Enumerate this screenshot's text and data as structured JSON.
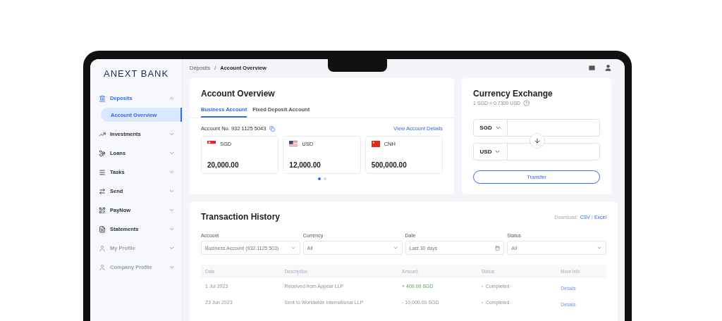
{
  "brand": "ANEXT BANK",
  "breadcrumb": {
    "parent": "Deposits",
    "separator": "/",
    "current": "Account Overview"
  },
  "sidebar": {
    "items": [
      {
        "label": "Deposits",
        "expanded": true,
        "disabled": false,
        "children": [
          {
            "label": "Account Overview",
            "selected": true
          }
        ]
      },
      {
        "label": "Investments",
        "expanded": false,
        "disabled": false
      },
      {
        "label": "Loans",
        "expanded": false,
        "disabled": false
      },
      {
        "label": "Tasks",
        "expanded": false,
        "disabled": false
      },
      {
        "label": "Send",
        "expanded": false,
        "disabled": false
      },
      {
        "label": "PayNow",
        "expanded": false,
        "disabled": false
      },
      {
        "label": "Statements",
        "expanded": false,
        "disabled": false
      },
      {
        "label": "My Profile",
        "expanded": false,
        "disabled": true
      },
      {
        "label": "Company Profile",
        "expanded": false,
        "disabled": true
      }
    ]
  },
  "account_overview": {
    "title": "Account Overview",
    "tabs": [
      {
        "label": "Business Account",
        "selected": true
      },
      {
        "label": "Fixed Deposit Account",
        "selected": false
      }
    ],
    "account_number": "Account No. 932 1125 5043",
    "details_link": "View Account Details",
    "balances": [
      {
        "kind": "sg",
        "currency": "SGD",
        "amount": "20,000.00"
      },
      {
        "kind": "us",
        "currency": "USD",
        "amount": "12,000.00"
      },
      {
        "kind": "cn",
        "currency": "CNH",
        "amount": "500,000.00"
      }
    ],
    "pages": [
      {
        "selected": true
      },
      {
        "selected": false
      }
    ]
  },
  "currency_exchange": {
    "title": "Currency Exchange",
    "rate": "1 SGD = 0.7300 USD",
    "from_currency": "SGD",
    "to_currency": "USD",
    "button": "Transfer"
  },
  "transaction_history": {
    "title": "Transaction History",
    "download_label": "Download:",
    "download_links": [
      "CSV",
      "Excel"
    ],
    "download_separator": "|",
    "filters": [
      {
        "label": "Account",
        "value": "Business Account (932 1125 503)",
        "kind": "select"
      },
      {
        "label": "Currency",
        "value": "All",
        "kind": "select"
      },
      {
        "label": "Date",
        "value": "Last 30 days",
        "kind": "date"
      },
      {
        "label": "Status",
        "value": "All",
        "kind": "select"
      }
    ],
    "columns": [
      "Date",
      "Description",
      "Amount",
      "Status",
      "More Info"
    ],
    "rows": [
      {
        "date": "1 Jul 2023",
        "description": "Received from Appear LLP",
        "amount": "+ 400.00 SGD",
        "kind": "credit",
        "status": "Completed",
        "more_info": "Details"
      },
      {
        "date": "23 Jun 2023",
        "description": "Sent to Worldwide International LLP",
        "amount": "- 10,000.00 SGD",
        "kind": "debit",
        "status": "Completed",
        "more_info": "Details"
      }
    ]
  }
}
